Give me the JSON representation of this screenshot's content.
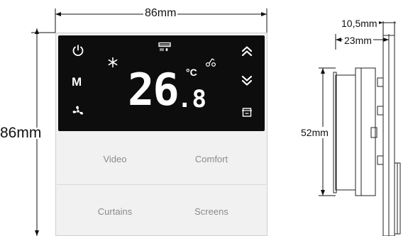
{
  "dimensions": {
    "front_width": "86mm",
    "front_height": "86mm",
    "side_depth_total": "10,5mm",
    "side_body_depth": "23mm",
    "side_height": "52mm"
  },
  "display": {
    "temperature_integer": "26",
    "temperature_decimal": ".8",
    "unit": "°C",
    "mode_label": "M"
  },
  "buttons": {
    "top_left": "Video",
    "top_right": "Comfort",
    "bottom_left": "Curtains",
    "bottom_right": "Screens"
  },
  "colors": {
    "panel_background": "#0d0d0d",
    "body_background": "#f1f1f1",
    "button_text": "#8b8b8b",
    "icon_color": "#ffffff"
  },
  "icons": [
    "power-icon",
    "snowflake-icon",
    "heater-icon",
    "fan-icon",
    "fan-speed-icon",
    "chevron-up-icon",
    "chevron-down-icon",
    "mode-icon"
  ]
}
